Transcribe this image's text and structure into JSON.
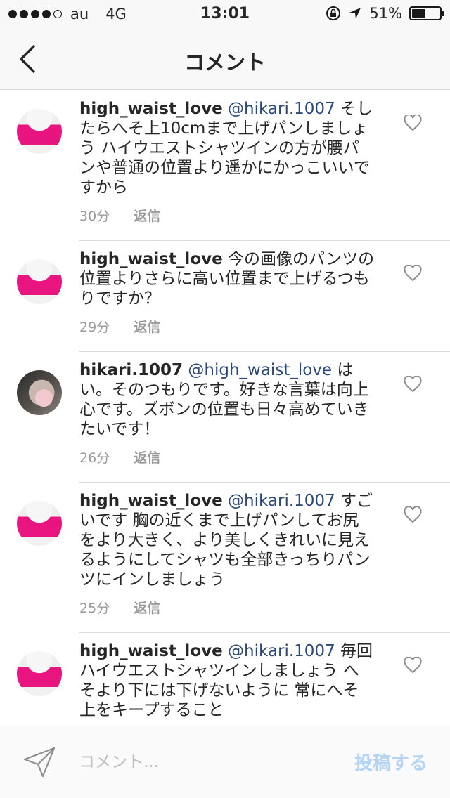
{
  "status_bar": {
    "carrier": "au",
    "network": "4G",
    "time": "13:01",
    "battery_text": "51%",
    "battery_level": 0.51
  },
  "nav": {
    "title": "コメント"
  },
  "comments": [
    {
      "username": "high_waist_love",
      "mention": "@hikari.1007",
      "text": " そしたらへそ上10cmまで上げパンしましょう ハイウエストシャツインの方が腰パンや普通の位置より遥かにかっこいいですから",
      "time": "30分",
      "reply": "返信"
    },
    {
      "username": "high_waist_love",
      "mention": "",
      "text": " 今の画像のパンツの位置よりさらに高い位置まで上げるつもりですか？",
      "time": "29分",
      "reply": "返信"
    },
    {
      "username": "hikari.1007",
      "mention": "@high_waist_love",
      "text": " はい。そのつもりです。好きな言葉は向上心です。ズボンの位置も日々高めていきたいです！",
      "time": "26分",
      "reply": "返信"
    },
    {
      "username": "high_waist_love",
      "mention": "@hikari.1007",
      "text": " すごいです 胸の近くまで上げパンしてお尻をより大きく、より美しくきれいに見えるようにしてシャツも全部きっちりパンツにインしましょう",
      "time": "25分",
      "reply": "返信"
    },
    {
      "username": "high_waist_love",
      "mention": "@hikari.1007",
      "text": " 毎回ハイウエストシャツインしましょう へそより下には下げないように 常にへそ上をキープすること",
      "time": "",
      "reply": ""
    }
  ],
  "input": {
    "placeholder": "コメント...",
    "post_label": "投稿する"
  },
  "colors": {
    "mention": "#2c4a79",
    "post_button_disabled": "#b3d4f5",
    "meta_gray": "#9a9a9a"
  }
}
